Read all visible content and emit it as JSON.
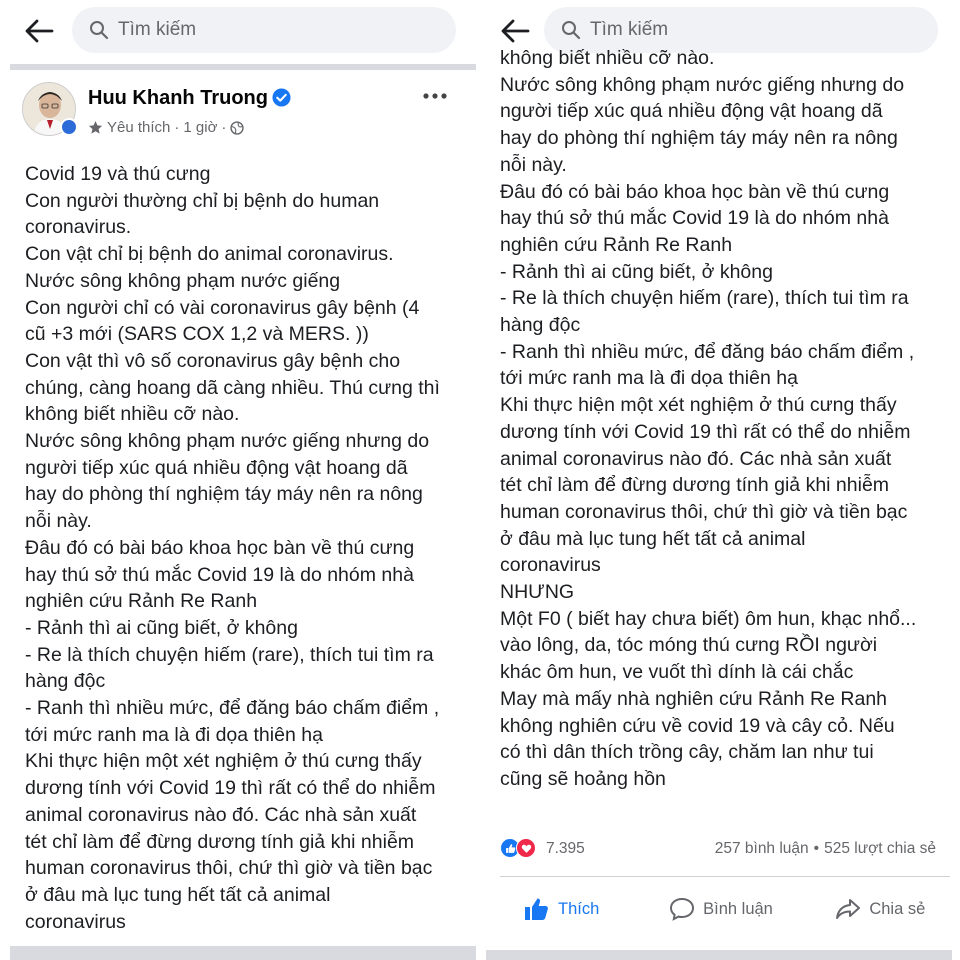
{
  "search": {
    "placeholder": "Tìm kiếm"
  },
  "post": {
    "author": "Huu Khanh Truong",
    "meta_follow": "Yêu thích",
    "meta_sep": "·",
    "meta_time": "1 giờ",
    "meta_sep2": "·"
  },
  "left_lines": [
    "Covid 19 và thú cưng",
    "Con người thường chỉ bị bệnh do human",
    "coronavirus.",
    "Con vật chỉ bị bệnh do animal coronavirus.",
    "Nước sông không phạm nước giếng",
    "Con người chỉ có vài coronavirus gây bệnh (4",
    "cũ +3 mới (SARS COX 1,2 và MERS. ))",
    "Con vật thì vô số coronavirus gây bệnh cho",
    "chúng, càng hoang dã càng nhiều. Thú cưng thì",
    "không biết nhiều cỡ nào.",
    "Nước sông không phạm nước giếng nhưng do",
    "người tiếp xúc quá nhiều động vật hoang dã",
    "hay do phòng thí nghiệm táy máy nên ra nông",
    "nỗi này.",
    "Đâu đó có bài báo khoa học bàn về thú cưng",
    "hay thú sở thú mắc Covid 19 là do nhóm nhà",
    "nghiên cứu Rảnh Re Ranh",
    "- Rảnh thì ai cũng biết, ở không",
    "- Re là thích chuyện hiếm (rare), thích tui tìm ra",
    "hàng độc",
    "- Ranh thì nhiều mức, để đăng báo chấm điểm ,",
    "tới mức ranh ma là đi dọa thiên hạ",
    "Khi thực hiện một xét nghiệm ở thú cưng thấy",
    "dương tính với Covid 19 thì rất có thể do nhiễm",
    "animal coronavirus nào đó. Các nhà sản xuất",
    "tét chỉ làm để đừng dương tính giả khi nhiễm",
    "human coronavirus thôi, chứ thì giờ và tiền bạc",
    "ở đâu mà lục tung hết tất cả animal",
    "coronavirus"
  ],
  "right_lines": [
    "không biết nhiều cỡ nào.",
    "Nước sông không phạm nước giếng nhưng do",
    "người tiếp xúc quá nhiều động vật hoang dã",
    "hay do phòng thí nghiệm táy máy nên ra nông",
    "nỗi này.",
    "Đâu đó có bài báo khoa học bàn về thú cưng",
    "hay thú sở thú mắc Covid 19 là do nhóm nhà",
    "nghiên cứu Rảnh Re Ranh",
    "- Rảnh thì ai cũng biết, ở không",
    "- Re là thích chuyện hiếm (rare), thích tui tìm ra",
    "hàng độc",
    "- Ranh thì nhiều mức, để đăng báo chấm điểm ,",
    "tới mức ranh ma là đi dọa thiên hạ",
    "Khi thực hiện một xét nghiệm ở thú cưng thấy",
    "dương tính với Covid 19 thì rất có thể do nhiễm",
    "animal coronavirus nào đó. Các nhà sản xuất",
    "tét chỉ làm để đừng dương tính giả khi nhiễm",
    "human coronavirus thôi, chứ thì giờ và tiền bạc",
    "ở đâu mà lục tung hết tất cả animal",
    "coronavirus",
    "NHƯNG",
    "Một F0 ( biết hay chưa biết) ôm hun, khạc nhổ...",
    "vào lông, da, tóc móng thú cưng RỒI người",
    "khác ôm hun, ve vuốt thì dính là cái chắc",
    "May mà mấy nhà nghiên cứu Rảnh Re Ranh",
    "không nghiên cứu về covid 19 và cây cỏ. Nếu",
    "có thì dân thích trồng cây, chăm lan như tui",
    "cũng sẽ hoảng hồn"
  ],
  "stats": {
    "reactions": "7.395",
    "comments": "257 bình luận",
    "dot": "•",
    "shares": "525 lượt chia sẻ"
  },
  "actions": {
    "like": "Thích",
    "comment": "Bình luận",
    "share": "Chia sẻ"
  },
  "colors": {
    "accent": "#1877f2",
    "love": "#f02849",
    "verified": "#1877f2"
  }
}
